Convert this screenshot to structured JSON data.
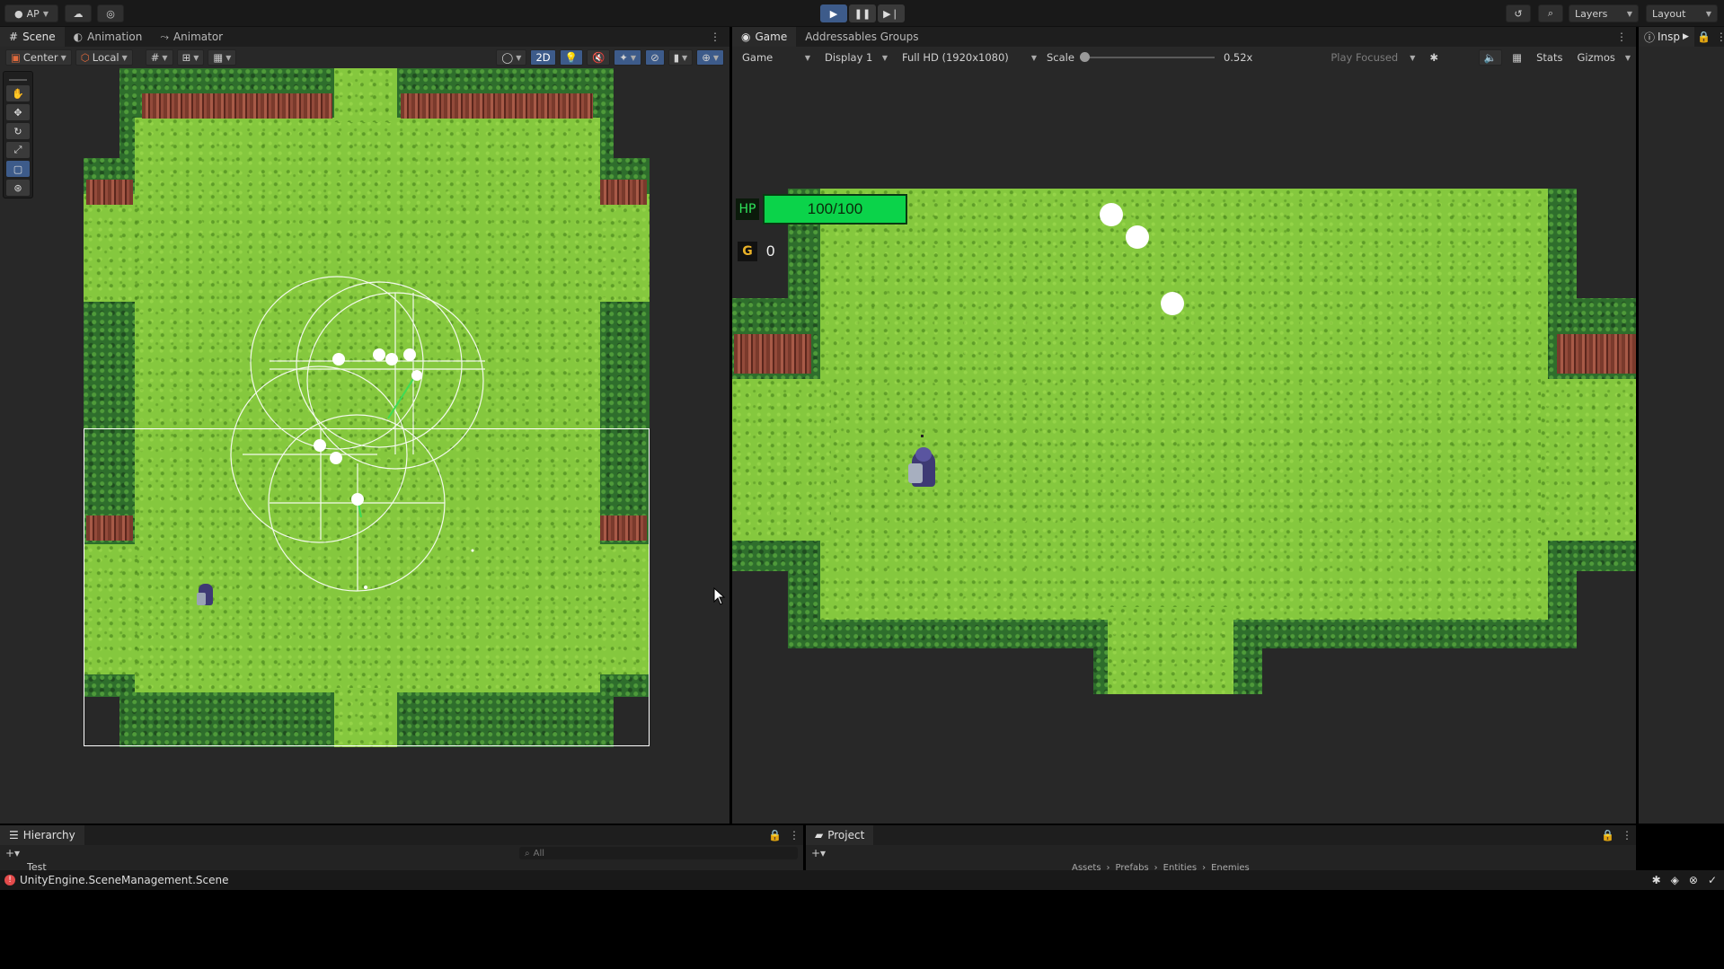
{
  "topbar": {
    "account_label": "AP",
    "layers_label": "Layers",
    "layout_label": "Layout"
  },
  "scene_panel": {
    "tabs": [
      "Scene",
      "Animation",
      "Animator"
    ],
    "pivot_label": "Center",
    "space_label": "Local",
    "mode_2d_label": "2D"
  },
  "game_panel": {
    "tabs": [
      "Game",
      "Addressables Groups"
    ],
    "view_select": "Game",
    "display_select": "Display 1",
    "resolution_select": "Full HD (1920x1080)",
    "scale_label": "Scale",
    "scale_value": "0.52x",
    "scale_fraction": 0.0,
    "play_mode_select": "Play Focused",
    "stats_label": "Stats",
    "gizmos_label": "Gizmos"
  },
  "hud": {
    "hp_label": "HP",
    "hp_value": "100/100",
    "hp_fraction": 1.0,
    "gold_label": "G",
    "gold_value": "0"
  },
  "inspector": {
    "tab_label": "Insp"
  },
  "hierarchy": {
    "tab_label": "Hierarchy",
    "search_placeholder": "All",
    "root_item": "Test"
  },
  "project": {
    "tab_label": "Project",
    "breadcrumb": [
      "Assets",
      "Prefabs",
      "Entities",
      "Enemies"
    ]
  },
  "status_bar": {
    "message": "UnityEngine.SceneManagement.Scene"
  },
  "colors": {
    "accent": "#3d5b8a",
    "hp_green": "#0bd34a",
    "grass": "#85c83e",
    "hedge": "#2e6e2c",
    "gold": "#e8b128"
  },
  "icons": [
    "play-icon",
    "pause-icon",
    "step-icon",
    "cloud-icon",
    "history-icon",
    "search-icon",
    "hand-tool-icon",
    "move-tool-icon",
    "rotate-tool-icon",
    "scale-tool-icon",
    "rect-tool-icon",
    "transform-tool-icon",
    "lock-icon",
    "kebab-icon",
    "error-icon",
    "bug-icon"
  ]
}
